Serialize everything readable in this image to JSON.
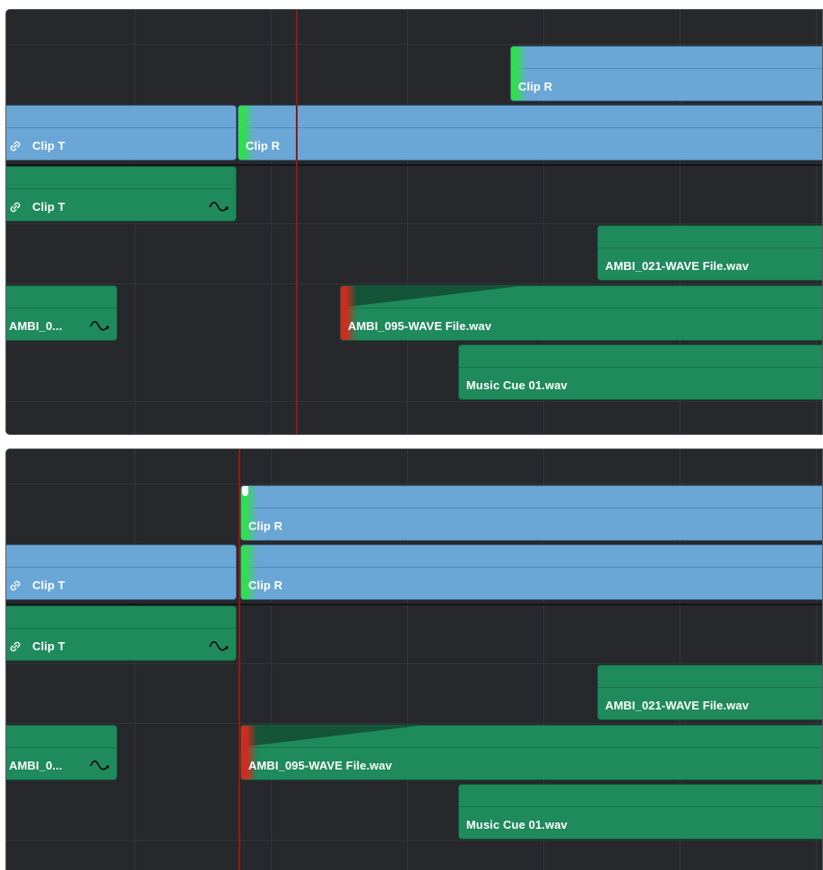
{
  "clips": {
    "clip_r": "Clip R",
    "clip_t": "Clip T",
    "ambi_021": "AMBI_021-WAVE File.wav",
    "ambi_095": "AMBI_095-WAVE File.wav",
    "ambi_short": "AMBI_0...",
    "music_cue": "Music Cue 01.wav"
  },
  "icons": {
    "link": "link-icon",
    "curve": "audio-curve-icon",
    "marker": "edit-point-flag-icon"
  },
  "colors": {
    "video_clip": "#6aa6d6",
    "audio_clip": "#1f8a5c",
    "playhead": "#8e1a16",
    "edit_green": "#2fe04a",
    "edit_red": "#d42a1e",
    "timeline_bg": "#27282c"
  }
}
